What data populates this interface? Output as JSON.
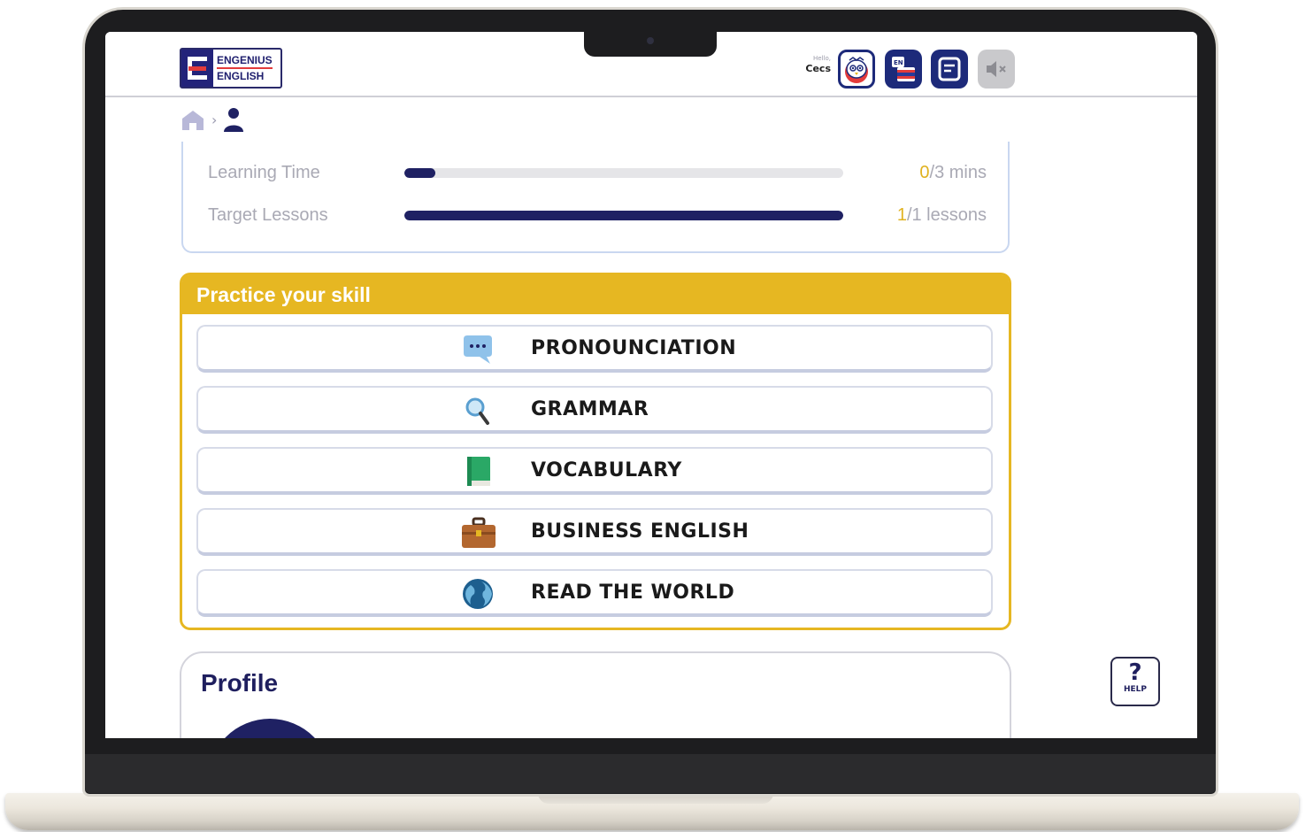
{
  "brand": {
    "logo_line1": "ENGENIUS",
    "logo_line2": "ENGLISH"
  },
  "user": {
    "greeting": "Hello,",
    "name": "Cecs"
  },
  "toolbar": {
    "buttons": [
      {
        "icon": "mascot-icon"
      },
      {
        "icon": "language-flag-icon"
      },
      {
        "icon": "notes-icon"
      },
      {
        "icon": "sound-muted-icon"
      }
    ]
  },
  "breadcrumb": {
    "separator": "›",
    "items": [
      "home-icon",
      "profile-icon"
    ]
  },
  "progress": [
    {
      "label": "Learning Time",
      "current": "0",
      "rest": "/3 mins",
      "fraction": 0.07
    },
    {
      "label": "Target Lessons",
      "current": "1",
      "rest": "/1 lessons",
      "fraction": 1.0
    }
  ],
  "practice": {
    "title": "Practice your skill",
    "skills": [
      {
        "label": "PRONOUNCIATION",
        "icon": "speech-bubble-icon"
      },
      {
        "label": "GRAMMAR",
        "icon": "magnifier-icon"
      },
      {
        "label": "VOCABULARY",
        "icon": "book-icon"
      },
      {
        "label": "BUSINESS ENGLISH",
        "icon": "briefcase-icon"
      },
      {
        "label": "READ THE WORLD",
        "icon": "globe-icon"
      }
    ]
  },
  "profile": {
    "title": "Profile"
  },
  "help": {
    "label": "HELP",
    "symbol": "?"
  },
  "colors": {
    "navy": "#1f2163",
    "gold": "#e6b722",
    "text_gray": "#a9a9b4"
  }
}
